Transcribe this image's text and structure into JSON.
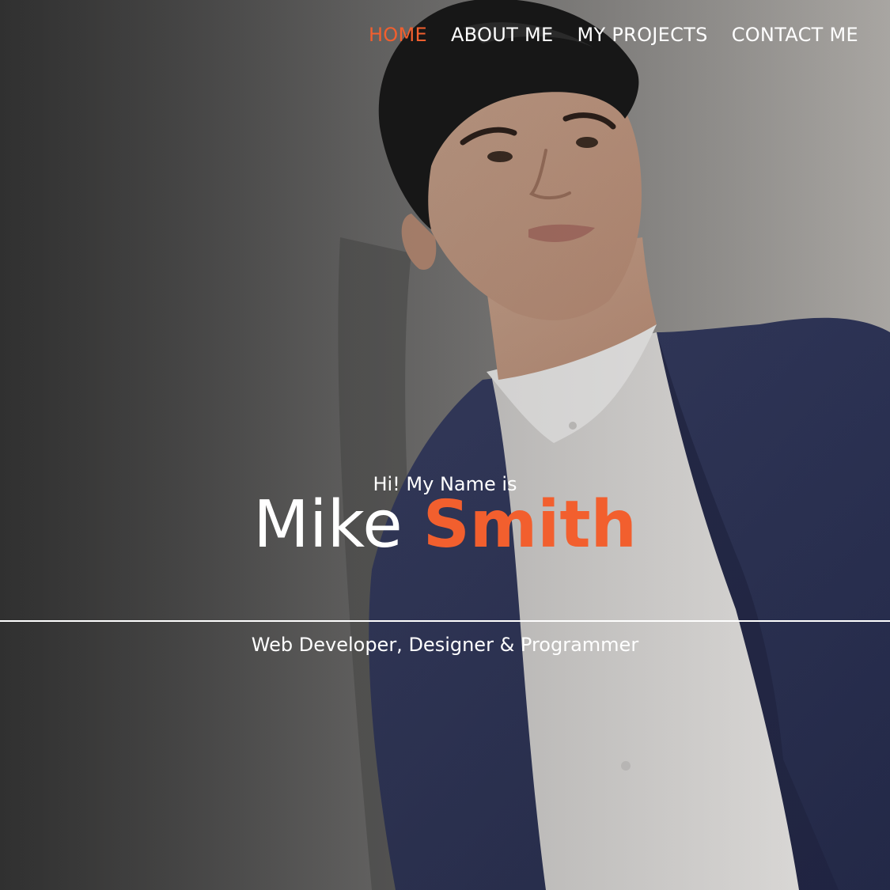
{
  "nav": {
    "items": [
      {
        "label": "HOME",
        "active": true
      },
      {
        "label": "ABOUT ME",
        "active": false
      },
      {
        "label": "MY PROJECTS",
        "active": false
      },
      {
        "label": "CONTACT ME",
        "active": false
      }
    ]
  },
  "hero": {
    "intro": "Hi! My Name is",
    "first_name": "Mike",
    "last_name": "Smith",
    "tagline": "Web Developer, Designer & Programmer"
  },
  "colors": {
    "accent": "#f25f2e",
    "text": "#ffffff",
    "jacket": "#2c3356",
    "shirt": "#dedcda"
  },
  "icons": [
    "portrait-photo"
  ]
}
